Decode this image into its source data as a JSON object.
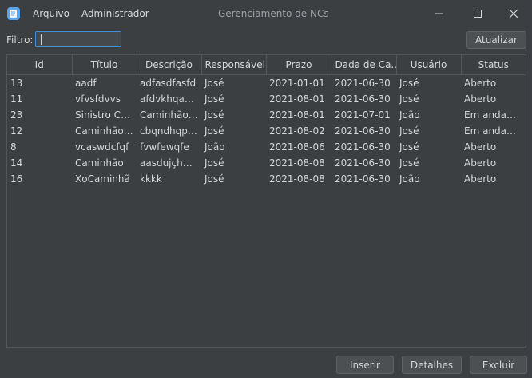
{
  "menu": {
    "file": "Arquivo",
    "admin": "Administrador"
  },
  "window": {
    "title": "Gerenciamento de NCs"
  },
  "filter": {
    "label": "Filtro:",
    "value": ""
  },
  "buttons": {
    "refresh": "Atualizar",
    "insert": "Inserir",
    "details": "Detalhes",
    "delete": "Excluir"
  },
  "table": {
    "headers": [
      "Id",
      "Título",
      "Descrição",
      "Responsável",
      "Prazo",
      "Dada de Ca...",
      "Usuário",
      "Status"
    ],
    "rows": [
      [
        "13",
        "aadf",
        "adfasdfasfd",
        "José",
        "2021-01-01",
        "2021-06-30",
        "José",
        "Aberto"
      ],
      [
        "11",
        "vfvsfdvvs",
        "afdvkhqabd...",
        "José",
        "2021-08-01",
        "2021-06-30",
        "José",
        "Aberto"
      ],
      [
        "23",
        "Sinistro Ca...",
        "Caminhão p...",
        "José",
        "2021-08-01",
        "2021-07-01",
        "João",
        "Em andame..."
      ],
      [
        "12",
        "Caminhão r...",
        "cbqndhqpió...",
        "José",
        "2021-08-02",
        "2021-06-30",
        "José",
        "Em andame..."
      ],
      [
        "8",
        "vcaswdcfqf",
        "fvwfewqfe",
        "João",
        "2021-08-06",
        "2021-06-30",
        "José",
        "Aberto"
      ],
      [
        "14",
        "Caminhão",
        "aasdujçhadf...",
        "José",
        "2021-08-08",
        "2021-06-30",
        "José",
        "Aberto"
      ],
      [
        "16",
        "XoCaminhã",
        "kkkk",
        "José",
        "2021-08-08",
        "2021-06-30",
        "João",
        "Aberto"
      ]
    ]
  },
  "icons": {
    "app": "notes-app-icon",
    "minimize": "minimize-icon",
    "maximize": "maximize-icon",
    "close": "close-icon"
  },
  "colors": {
    "accent": "#3f8fd9",
    "background": "#3c3f41"
  }
}
